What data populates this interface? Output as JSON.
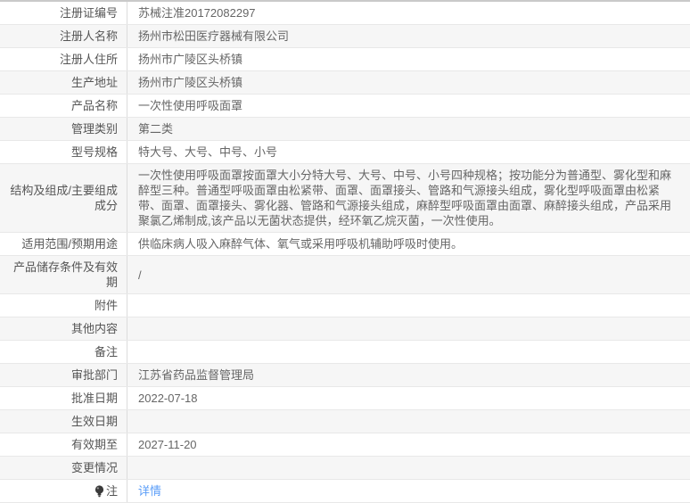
{
  "page": {
    "background_color": "#ececec",
    "table_background_color": "#ffffff",
    "alt_row_color": "#f6f6f6",
    "border_color": "#e8e8e8",
    "divider_color": "#dcdcdc",
    "top_border_color": "#c9c9c9",
    "label_text_color": "#555555",
    "value_text_color": "#666666",
    "link_color": "#5a9df8"
  },
  "table": {
    "rows": [
      {
        "label": "注册证编号",
        "value": "苏械注准20172082297",
        "type": "text"
      },
      {
        "label": "注册人名称",
        "value": "扬州市松田医疗器械有限公司",
        "type": "text"
      },
      {
        "label": "注册人住所",
        "value": "扬州市广陵区头桥镇",
        "type": "text"
      },
      {
        "label": "生产地址",
        "value": "扬州市广陵区头桥镇",
        "type": "text"
      },
      {
        "label": "产品名称",
        "value": "一次性使用呼吸面罩",
        "type": "text"
      },
      {
        "label": "管理类别",
        "value": "第二类",
        "type": "text"
      },
      {
        "label": "型号规格",
        "value": "特大号、大号、中号、小号",
        "type": "text"
      },
      {
        "label": "结构及组成/主要组成成分",
        "value": "一次性使用呼吸面罩按面罩大小分特大号、大号、中号、小号四种规格；按功能分为普通型、雾化型和麻醉型三种。普通型呼吸面罩由松紧带、面罩、面罩接头、管路和气源接头组成，雾化型呼吸面罩由松紧带、面罩、面罩接头、雾化器、管路和气源接头组成，麻醉型呼吸面罩由面罩、麻醉接头组成，产品采用聚氯乙烯制成,该产品以无菌状态提供，经环氧乙烷灭菌，一次性使用。",
        "type": "text"
      },
      {
        "label": "适用范围/预期用途",
        "value": "供临床病人吸入麻醉气体、氧气或采用呼吸机辅助呼吸时使用。",
        "type": "text"
      },
      {
        "label": "产品储存条件及有效期",
        "value": "/",
        "type": "text"
      },
      {
        "label": "附件",
        "value": "",
        "type": "text"
      },
      {
        "label": "其他内容",
        "value": "",
        "type": "text"
      },
      {
        "label": "备注",
        "value": "",
        "type": "text"
      },
      {
        "label": "审批部门",
        "value": "江苏省药品监督管理局",
        "type": "text"
      },
      {
        "label": "批准日期",
        "value": "2022-07-18",
        "type": "text"
      },
      {
        "label": "生效日期",
        "value": "",
        "type": "text"
      },
      {
        "label": "有效期至",
        "value": "2027-11-20",
        "type": "text"
      },
      {
        "label": "变更情况",
        "value": "",
        "type": "text"
      },
      {
        "label": "注",
        "value": "详情",
        "type": "link",
        "icon": "lightbulb-icon"
      }
    ]
  }
}
